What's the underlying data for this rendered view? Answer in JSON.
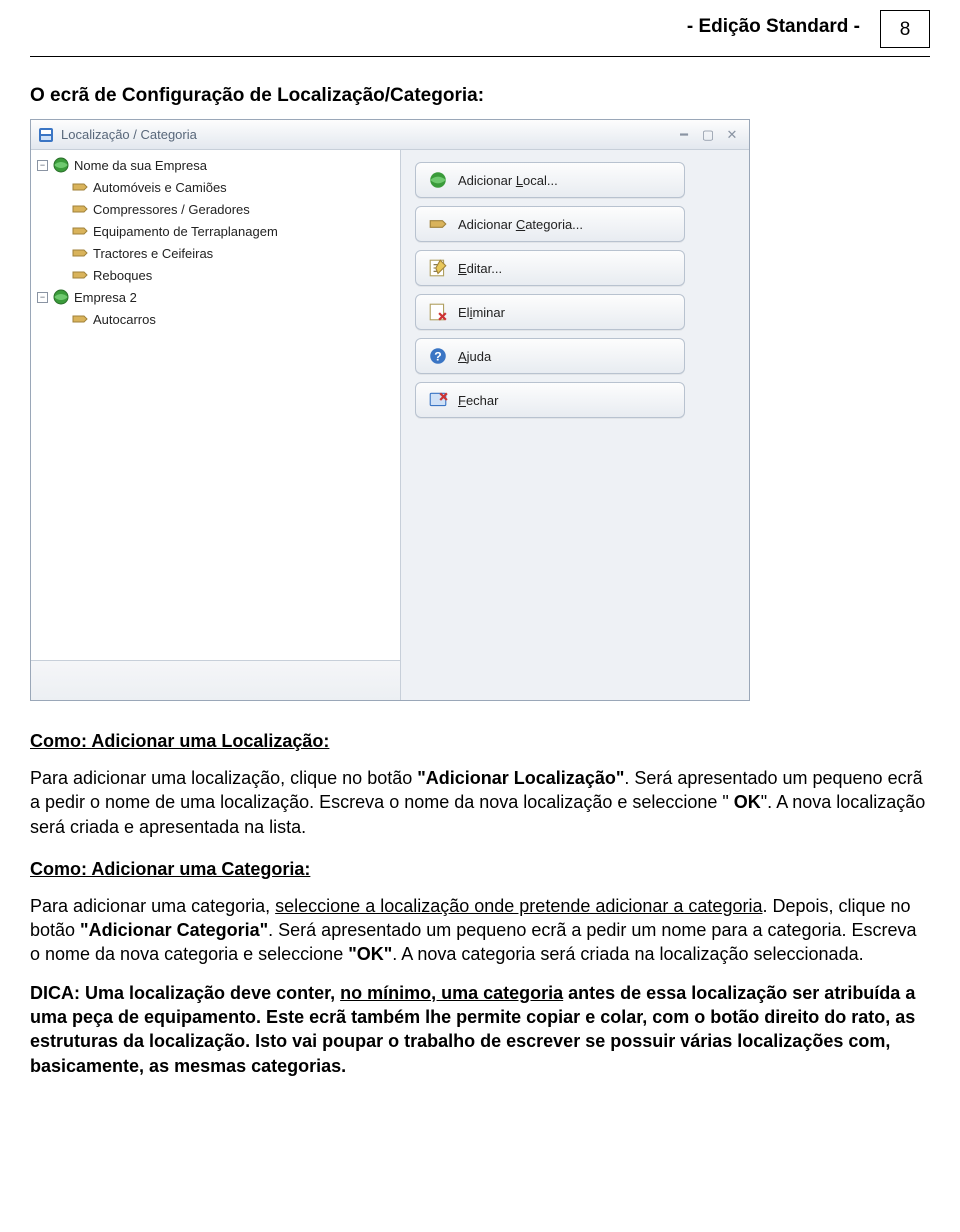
{
  "header": {
    "title": "- Edição Standard -",
    "page": "8"
  },
  "section_title": "O ecrã de Configuração de Localização/Categoria:",
  "window": {
    "title": "Localização / Categoria",
    "tree": {
      "root1": {
        "label": "Nome da sua Empresa",
        "expanded": true
      },
      "root1_children": [
        "Automóveis e Camiões",
        "Compressores / Geradores",
        "Equipamento de Terraplanagem",
        "Tractores e Ceifeiras",
        "Reboques"
      ],
      "root2": {
        "label": "Empresa 2",
        "expanded": true
      },
      "root2_children": [
        "Autocarros"
      ]
    },
    "buttons": {
      "add_local": {
        "pre": "Adicionar ",
        "accel": "L",
        "post": "ocal..."
      },
      "add_cat": {
        "pre": "Adicionar ",
        "accel": "C",
        "post": "ategoria..."
      },
      "edit": {
        "pre": "",
        "accel": "E",
        "post": "ditar..."
      },
      "delete": {
        "pre": "El",
        "accel": "i",
        "post": "minar"
      },
      "help": {
        "pre": "",
        "accel": "A",
        "post": "juda"
      },
      "close": {
        "pre": "",
        "accel": "F",
        "post": "echar"
      }
    }
  },
  "howto_loc": {
    "heading": "Como: Adicionar uma Localização:",
    "p1_a": "Para adicionar uma localização, clique no botão ",
    "p1_b": "\"Adicionar Localização\"",
    "p1_c": ". Será apresentado um pequeno ecrã a pedir o nome de uma localização. Escreva o nome da nova localização e seleccione \" ",
    "p1_d": "OK",
    "p1_e": "\". A nova localização será criada e apresentada na lista."
  },
  "howto_cat": {
    "heading": "Como: Adicionar uma Categoria:",
    "p1_a": "Para adicionar uma categoria, ",
    "p1_b": "seleccione a localização onde pretende adicionar a categoria",
    "p1_c": ". Depois, clique no botão ",
    "p1_d": "\"Adicionar Categoria\"",
    "p1_e": ". Será apresentado um pequeno ecrã a pedir um nome para a categoria. Escreva o nome da nova categoria e seleccione ",
    "p1_f": "\"OK\"",
    "p1_g": ". A nova categoria será criada na localização seleccionada."
  },
  "tip": {
    "a": "DICA: Uma localização deve conter, ",
    "b": "no mínimo, uma categoria",
    "c": " antes de essa localização ser atribuída a uma peça de equipamento. Este ecrã também lhe permite copiar e colar, com o botão direito do rato, as estruturas da localização. Isto vai poupar o trabalho de escrever se possuir várias localizações com, basicamente, as mesmas categorias."
  }
}
